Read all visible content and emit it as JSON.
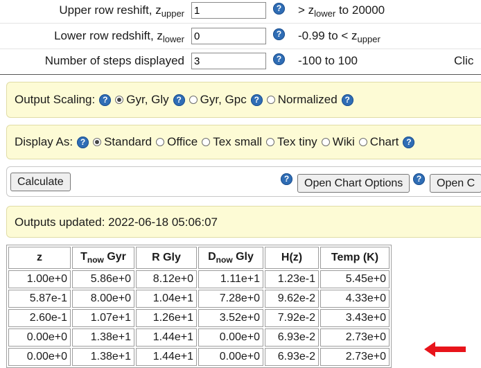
{
  "inputs": {
    "upper": {
      "label_pre": "Upper row reshift, z",
      "label_sub": "upper",
      "value": "1",
      "range_pre": "> z",
      "range_sub": "lower",
      "range_post": " to 20000"
    },
    "lower": {
      "label_pre": "Lower row redshift, z",
      "label_sub": "lower",
      "value": "0",
      "range_pre": "-0.99 to < z",
      "range_sub": "upper"
    },
    "steps": {
      "label": "Number of steps displayed",
      "value": "3",
      "range": "-100 to 100",
      "clipped": "Clic"
    }
  },
  "help_glyph": "?",
  "output_scaling": {
    "label": "Output Scaling:",
    "options": [
      "Gyr, Gly",
      "Gyr, Gpc",
      "Normalized"
    ],
    "selected": "Gyr, Gly"
  },
  "display_as": {
    "label": "Display As:",
    "options": [
      "Standard",
      "Office",
      "Tex small",
      "Tex tiny",
      "Wiki",
      "Chart"
    ],
    "selected": "Standard"
  },
  "buttons": {
    "calculate": "Calculate",
    "open_chart_options": "Open Chart Options",
    "open_clipped": "Open C"
  },
  "status": {
    "text": "Outputs updated: 2022-06-18 05:06:07"
  },
  "table": {
    "headers": [
      {
        "pre": "z",
        "sub": "",
        "post": ""
      },
      {
        "pre": "T",
        "sub": "now",
        "post": " Gyr"
      },
      {
        "pre": "R Gly",
        "sub": "",
        "post": ""
      },
      {
        "pre": "D",
        "sub": "now",
        "post": " Gly"
      },
      {
        "pre": "H(z)",
        "sub": "",
        "post": ""
      },
      {
        "pre": "Temp (K)",
        "sub": "",
        "post": ""
      }
    ],
    "rows": [
      [
        "1.00e+0",
        "5.86e+0",
        "8.12e+0",
        "1.11e+1",
        "1.23e-1",
        "5.45e+0"
      ],
      [
        "5.87e-1",
        "8.00e+0",
        "1.04e+1",
        "7.28e+0",
        "9.62e-2",
        "4.33e+0"
      ],
      [
        "2.60e-1",
        "1.07e+1",
        "1.26e+1",
        "3.52e+0",
        "7.92e-2",
        "3.43e+0"
      ],
      [
        "0.00e+0",
        "1.38e+1",
        "1.44e+1",
        "0.00e+0",
        "6.93e-2",
        "2.73e+0"
      ],
      [
        "0.00e+0",
        "1.38e+1",
        "1.44e+1",
        "0.00e+0",
        "6.93e-2",
        "2.73e+0"
      ]
    ]
  },
  "colors": {
    "panel_bg": "#fdfbd5",
    "help_icon": "#2f6db5",
    "arrow": "#e8141b"
  },
  "icons": {
    "help": "help-icon",
    "pointer": "red-arrow-icon"
  }
}
